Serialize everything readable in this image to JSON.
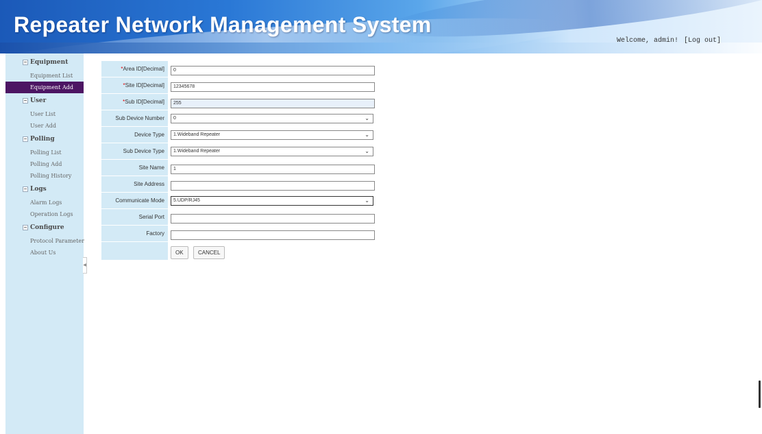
{
  "header": {
    "title": "Repeater Network Management System",
    "welcome": "Welcome, admin!",
    "logout": "[Log out]"
  },
  "sidebar": {
    "sections": [
      {
        "title": "Equipment",
        "items": [
          "Equipment List",
          "Equipment Add"
        ]
      },
      {
        "title": "User",
        "items": [
          "User List",
          "User Add"
        ]
      },
      {
        "title": "Polling",
        "items": [
          "Polling List",
          "Polling Add",
          "Polling History"
        ]
      },
      {
        "title": "Logs",
        "items": [
          "Alarm Logs",
          "Operation Logs"
        ]
      },
      {
        "title": "Configure",
        "items": [
          "Protocol Parameter",
          "About Us"
        ]
      }
    ],
    "active_item": "Equipment Add"
  },
  "form": {
    "required_mark": "*",
    "area_id": {
      "label": "Area ID[Decimal]",
      "value": "0"
    },
    "site_id": {
      "label": "Site ID[Decimal]",
      "value": "12345678"
    },
    "sub_id": {
      "label": "Sub ID[Decimal]",
      "value": "255"
    },
    "sub_device_number": {
      "label": "Sub Device Number",
      "value": "0"
    },
    "device_type": {
      "label": "Device Type",
      "value": "1.Wideband Repeater"
    },
    "sub_device_type": {
      "label": "Sub Device Type",
      "value": "1.Wideband Repeater"
    },
    "site_name": {
      "label": "Site Name",
      "value": "1"
    },
    "site_address": {
      "label": "Site Address",
      "value": ""
    },
    "communicate_mode": {
      "label": "Communicate Mode",
      "value": "5.UDP/RJ45"
    },
    "serial_port": {
      "label": "Serial Port",
      "value": ""
    },
    "factory": {
      "label": "Factory",
      "value": ""
    },
    "ok_label": "OK",
    "cancel_label": "CANCEL"
  },
  "colors": {
    "sidebar_bg": "#d3eaf6",
    "active_item_bg": "#4c1563",
    "banner_blue": "#1b59b8"
  }
}
